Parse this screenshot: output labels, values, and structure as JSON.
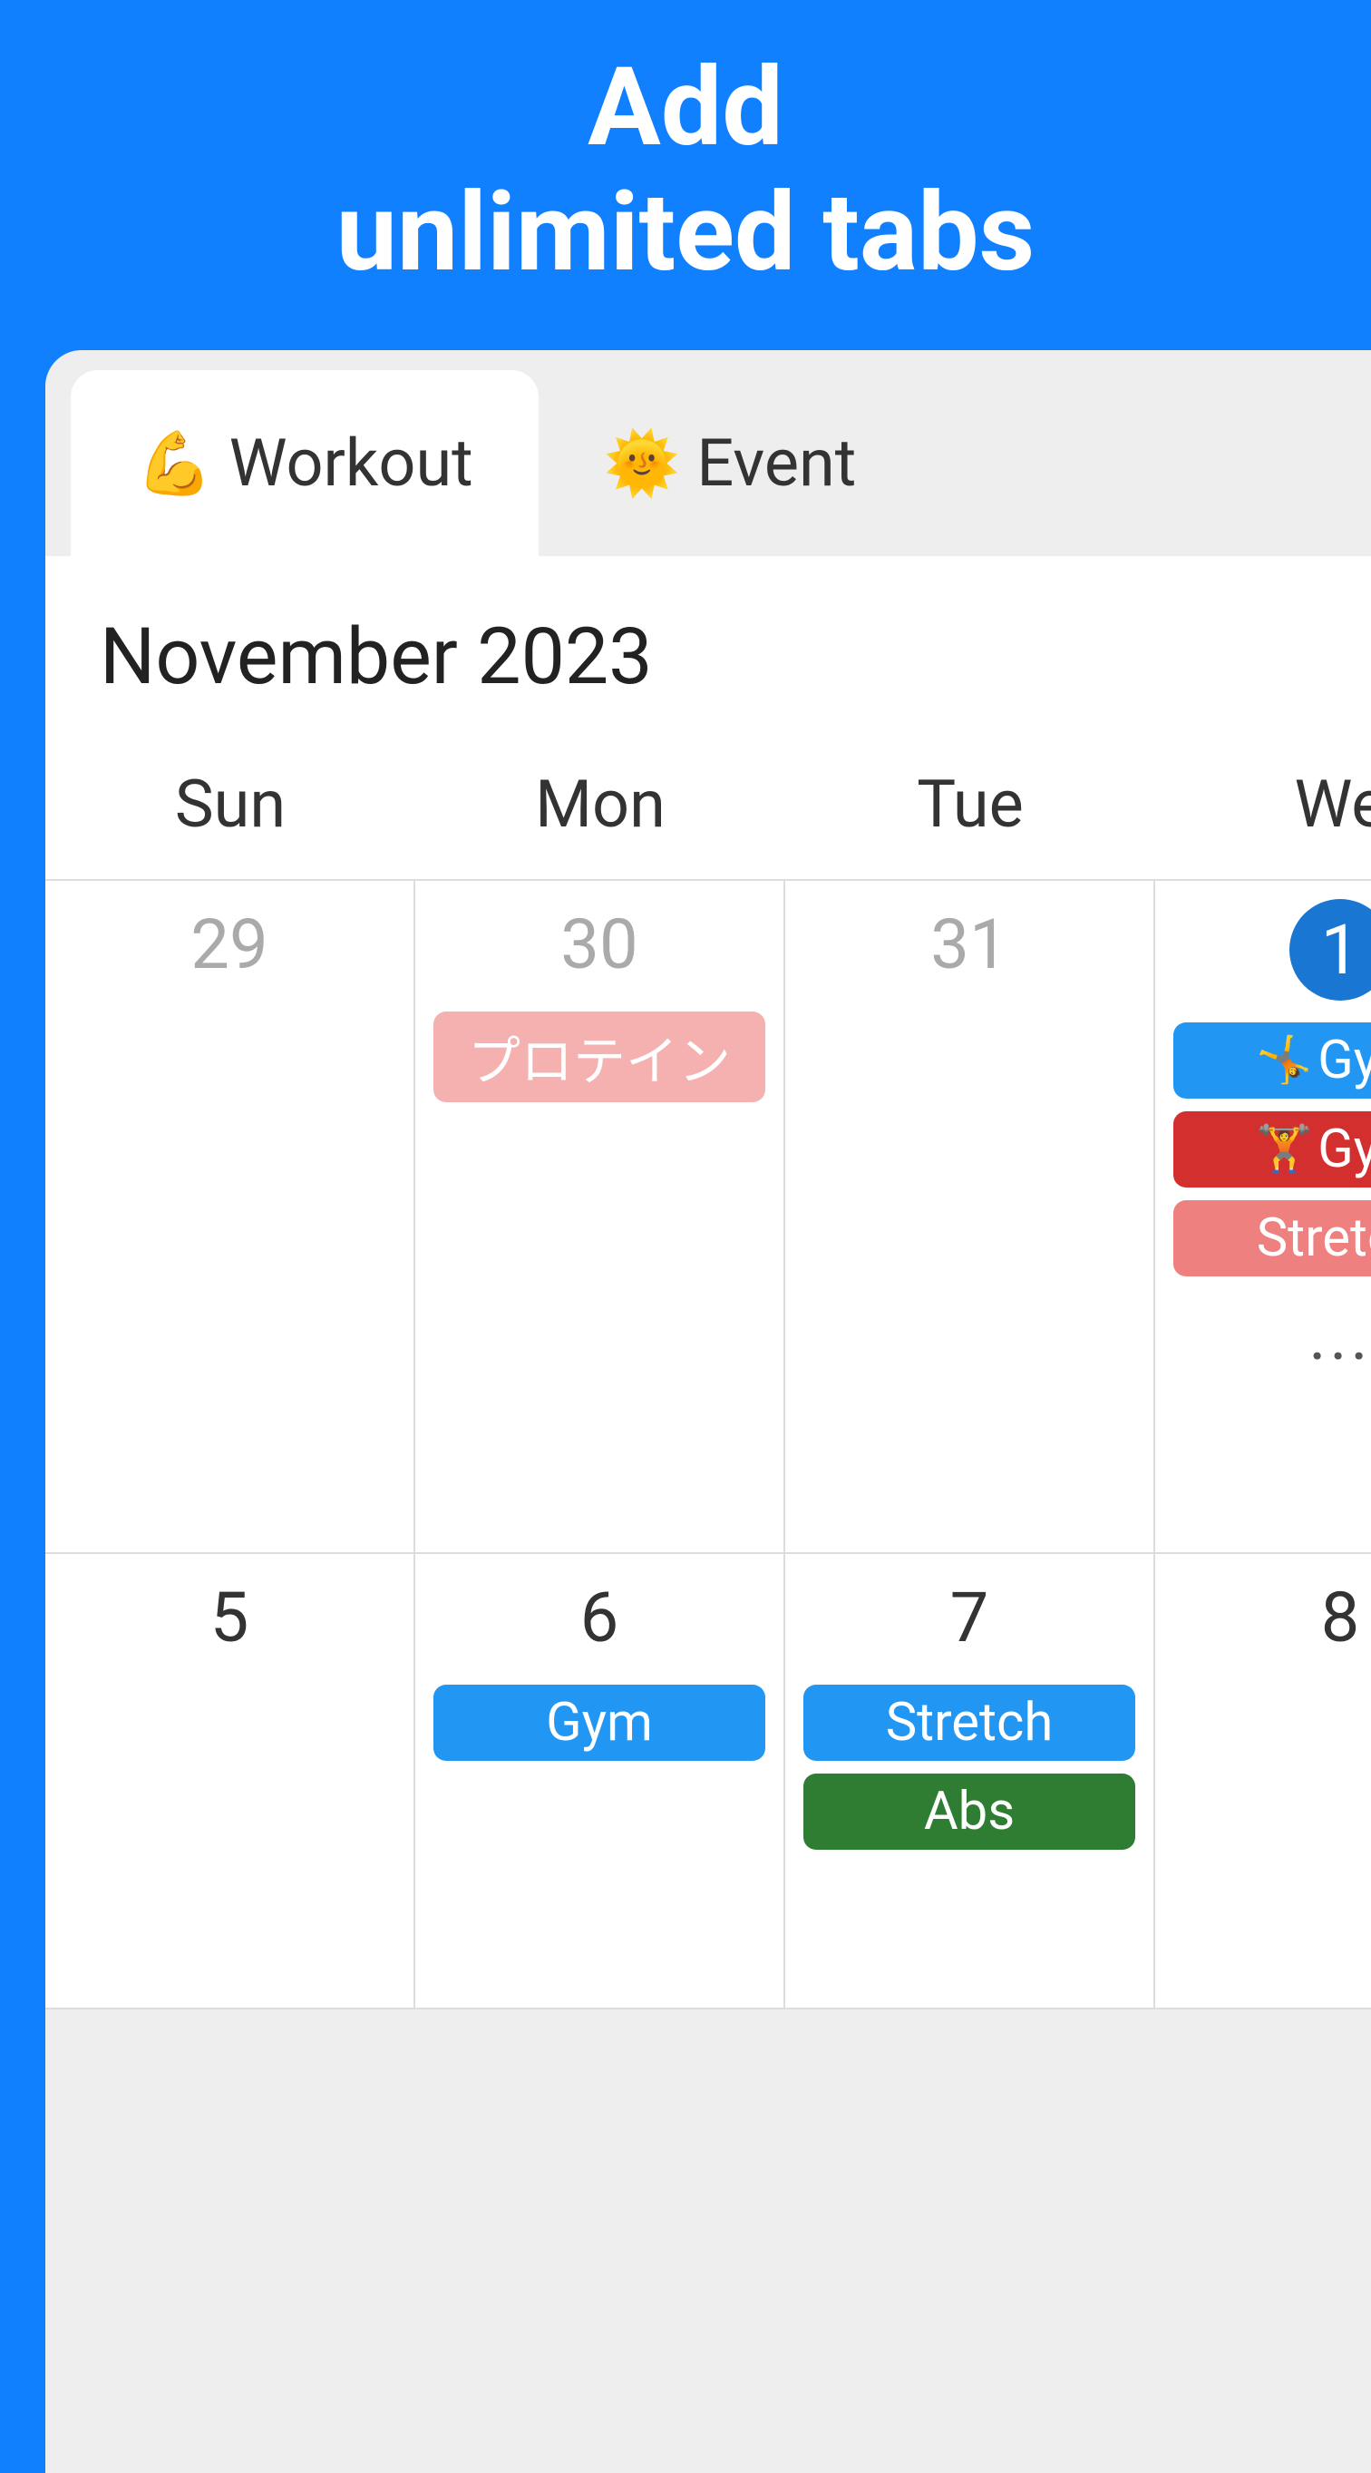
{
  "header": {
    "line1": "Add",
    "line2": "unlimited tabs"
  },
  "tabs": [
    {
      "emoji": "💪",
      "label": "Workout",
      "active": true
    },
    {
      "emoji": "🌞",
      "label": "Event",
      "active": false
    }
  ],
  "calendar": {
    "month_title": "November 2023",
    "day_headers": [
      "Sun",
      "Mon",
      "Tue",
      "We"
    ],
    "rows": [
      {
        "cells": [
          {
            "date": "29",
            "dimmed": true,
            "today": false,
            "events": [],
            "more": false
          },
          {
            "date": "30",
            "dimmed": true,
            "today": false,
            "events": [
              {
                "emoji": "",
                "label": "プロテイン",
                "color": "pink-faded"
              }
            ],
            "more": false
          },
          {
            "date": "31",
            "dimmed": true,
            "today": false,
            "events": [],
            "more": false
          },
          {
            "date": "1",
            "dimmed": false,
            "today": true,
            "events": [
              {
                "emoji": "🤸",
                "label": "Gym",
                "color": "blue"
              },
              {
                "emoji": "🏋️",
                "label": "Gym",
                "color": "red"
              },
              {
                "emoji": "",
                "label": "Stretch",
                "color": "pink"
              }
            ],
            "more": true
          }
        ]
      },
      {
        "cells": [
          {
            "date": "5",
            "dimmed": false,
            "today": false,
            "events": [],
            "more": false
          },
          {
            "date": "6",
            "dimmed": false,
            "today": false,
            "events": [
              {
                "emoji": "",
                "label": "Gym",
                "color": "blue"
              }
            ],
            "more": false
          },
          {
            "date": "7",
            "dimmed": false,
            "today": false,
            "events": [
              {
                "emoji": "",
                "label": "Stretch",
                "color": "blue"
              },
              {
                "emoji": "",
                "label": "Abs",
                "color": "green"
              }
            ],
            "more": false
          },
          {
            "date": "8",
            "dimmed": false,
            "today": false,
            "events": [],
            "more": false
          }
        ]
      }
    ],
    "more_indicator": "..."
  }
}
